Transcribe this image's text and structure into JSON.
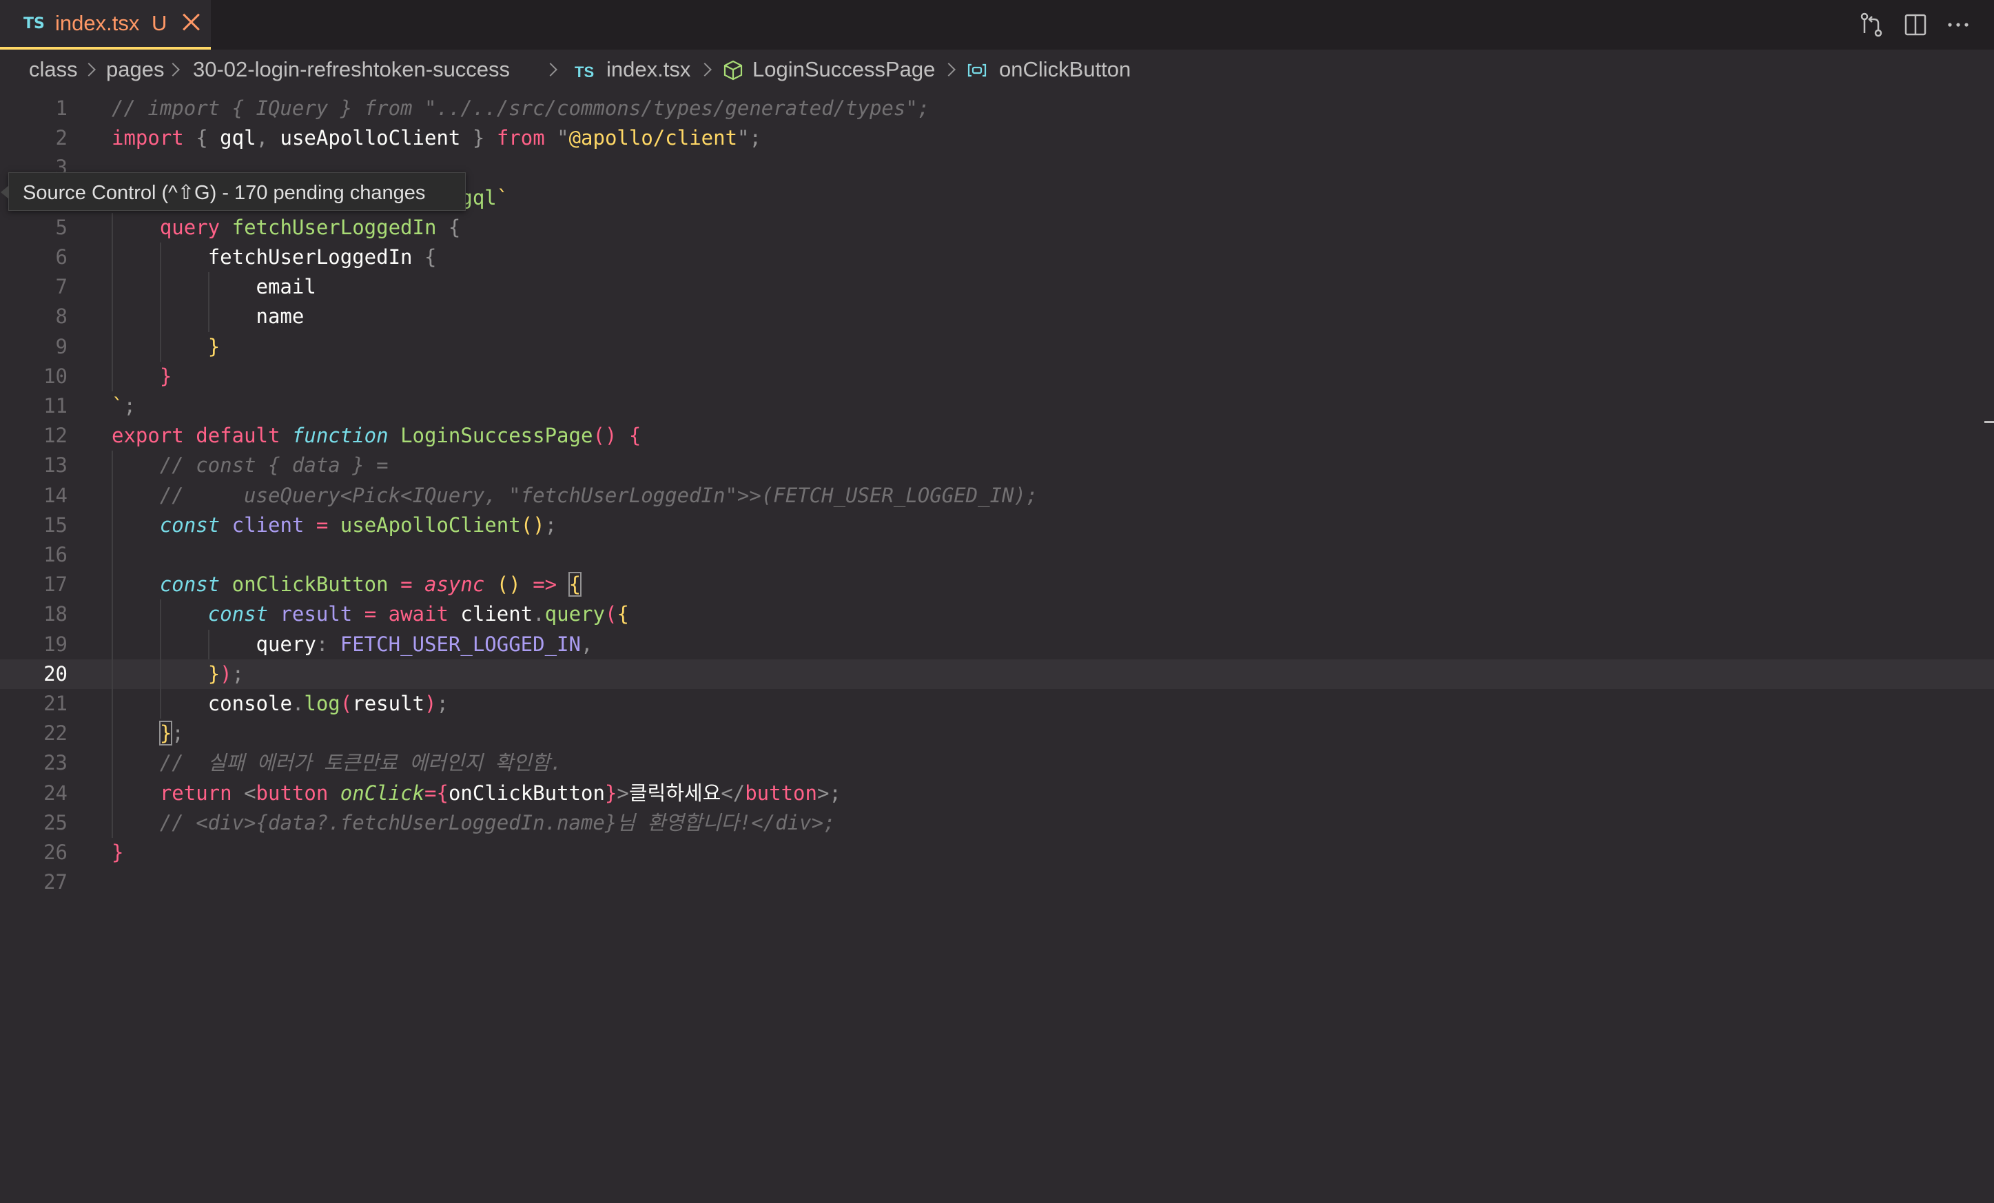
{
  "tab": {
    "lang": "TS",
    "filename": "index.tsx",
    "status": "U"
  },
  "colors": {
    "accent": "#ffd866",
    "tab_text": "#ff9866",
    "background": "#2d2a2e"
  },
  "actions": [
    "source-control-icon",
    "split-editor-icon",
    "more-actions-icon"
  ],
  "breadcrumbs": {
    "items": [
      "class",
      "pages",
      "30-02-login-refreshtoken-success",
      "index.tsx",
      "LoginSuccessPage",
      "onClickButton"
    ],
    "file_lang": "TS"
  },
  "tooltip": "Source Control (^⇧G) - 170 pending changes",
  "editor": {
    "current_line": 20,
    "lines": [
      {
        "n": "1",
        "html": "<span class='c-com'>// import { IQuery } from \"../../src/commons/types/generated/types\";</span>"
      },
      {
        "n": "2",
        "html": "<span class='c-key'>import</span> <span class='c-pun'>{</span> <span class='c-var'>gql</span><span class='c-pun'>,</span> <span class='c-var'>useApolloClient</span> <span class='c-pun'>}</span> <span class='c-key'>from</span> <span class='c-pun'>\"</span><span class='c-str'>@apollo/client</span><span class='c-pun'>\";</span>"
      },
      {
        "n": "3",
        "html": ""
      },
      {
        "n": "4",
        "html": "<span class='c-key'>const</span> <span class='c-const'>FETCH_USER_LOGGED_IN</span> <span class='c-key'>=</span> <span class='c-fn'>gql</span><span class='c-str'>`</span>"
      },
      {
        "n": "5",
        "html": "    <span class='c-key'>query</span> <span class='c-fn'>fetchUserLoggedIn</span> <span class='c-pun'>{</span>"
      },
      {
        "n": "6",
        "html": "        <span class='c-var'>fetchUserLoggedIn</span> <span class='c-pun'>{</span>"
      },
      {
        "n": "7",
        "html": "            <span class='c-var'>email</span>"
      },
      {
        "n": "8",
        "html": "            <span class='c-var'>name</span>"
      },
      {
        "n": "9",
        "html": "        <span class='c-str'>}</span>"
      },
      {
        "n": "10",
        "html": "    <span class='c-key'>}</span>"
      },
      {
        "n": "11",
        "html": "<span class='c-str'>`</span><span class='c-pun'>;</span>"
      },
      {
        "n": "12",
        "html": "<span class='c-key'>export</span> <span class='c-key'>default</span> <span class='c-typ'>function</span> <span class='c-fn'>LoginSuccessPage</span><span class='c-key'>()</span> <span class='c-key'>{</span>"
      },
      {
        "n": "13",
        "html": "    <span class='c-com'>// const { data } =</span>"
      },
      {
        "n": "14",
        "html": "    <span class='c-com'>//     useQuery&lt;Pick&lt;IQuery, \"fetchUserLoggedIn\"&gt;&gt;(FETCH_USER_LOGGED_IN);</span>"
      },
      {
        "n": "15",
        "html": "    <span class='c-typ'>const</span> <span class='c-const'>client</span> <span class='c-key'>=</span> <span class='c-fn'>useApolloClient</span><span class='c-str'>()</span><span class='c-pun'>;</span>"
      },
      {
        "n": "16",
        "html": ""
      },
      {
        "n": "17",
        "html": "    <span class='c-typ'>const</span> <span class='c-fn'>onClickButton</span> <span class='c-key'>=</span> <span class='c-typ' style='color:#ff6188'>async</span> <span class='c-str'>()</span> <span class='c-key'>=&gt;</span> <span class='c-str bracket'>{</span>"
      },
      {
        "n": "18",
        "html": "        <span class='c-typ'>const</span> <span class='c-const'>result</span> <span class='c-key'>=</span> <span class='c-key'>await</span> <span class='c-var'>client</span><span class='c-pun'>.</span><span class='c-fn'>query</span><span class='c-key'>(</span><span class='c-str'>{</span>"
      },
      {
        "n": "19",
        "html": "            <span class='c-var'>query</span><span class='c-pun'>:</span> <span class='c-const'>FETCH_USER_LOGGED_IN</span><span class='c-pun'>,</span>"
      },
      {
        "n": "20",
        "html": "        <span class='c-str'>}</span><span class='c-key'>)</span><span class='c-pun'>;</span>"
      },
      {
        "n": "21",
        "html": "        <span class='c-var'>console</span><span class='c-pun'>.</span><span class='c-fn'>log</span><span class='c-key'>(</span><span class='c-var'>result</span><span class='c-key'>)</span><span class='c-pun'>;</span>"
      },
      {
        "n": "22",
        "html": "    <span class='c-str bracket'>}</span><span class='c-pun'>;</span>"
      },
      {
        "n": "23",
        "html": "    <span class='c-com'>//  실패 에러가 토큰만료 에러인지 확인함.</span>"
      },
      {
        "n": "24",
        "html": "    <span class='c-key'>return</span> <span class='c-pun'>&lt;</span><span class='c-key'>button</span> <span class='c-typ' style='color:#a9dc76'>onClick</span><span class='c-key'>=</span><span class='c-key'>{</span><span class='c-var'>onClickButton</span><span class='c-key'>}</span><span class='c-pun'>&gt;</span><span class='c-var'>클릭하세요</span><span class='c-pun'>&lt;/</span><span class='c-key'>button</span><span class='c-pun'>&gt;;</span>"
      },
      {
        "n": "25",
        "html": "    <span class='c-com'>// &lt;div&gt;{data?.fetchUserLoggedIn.name}님 환영합니다!&lt;/div&gt;;</span>"
      },
      {
        "n": "26",
        "html": "<span class='c-key'>}</span>"
      },
      {
        "n": "27",
        "html": ""
      }
    ]
  }
}
